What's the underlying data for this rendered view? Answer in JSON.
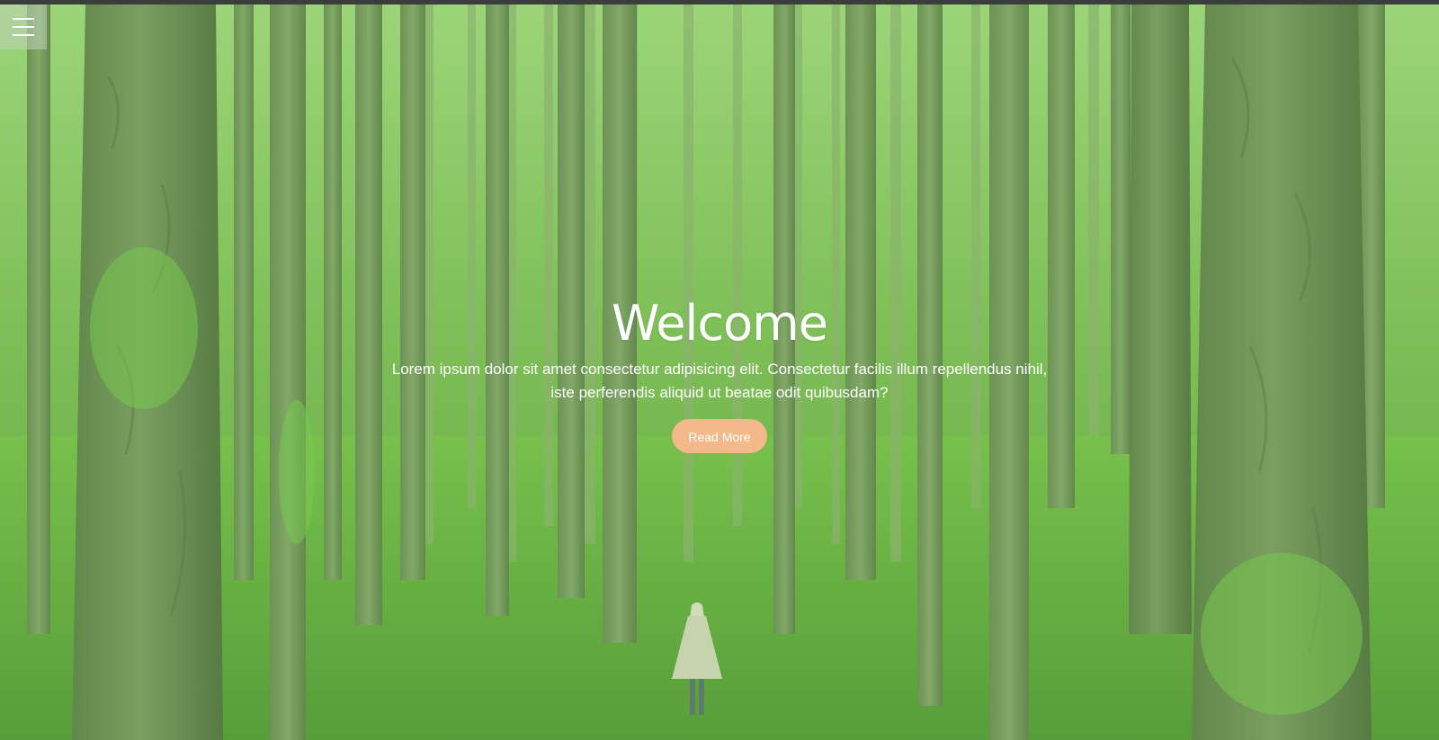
{
  "menu": {
    "icon": "hamburger-menu-icon"
  },
  "hero": {
    "title": "Welcome",
    "text": "Lorem ipsum dolor sit amet consectetur adipisicing elit. Consectetur facilis illum repellendus nihil, iste perferendis aliquid ut beatae odit quibusdam?",
    "button_label": "Read More"
  },
  "colors": {
    "button": "#f3b98a",
    "overlay": "#96d278",
    "forest_floor": "#5aa03a",
    "tree_trunk": "#6c8a55"
  }
}
